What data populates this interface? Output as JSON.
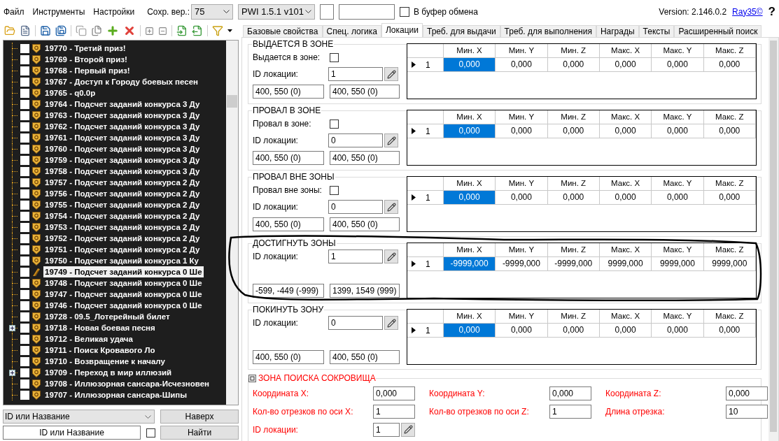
{
  "menu": [
    "Файл",
    "Инструменты",
    "Настройки"
  ],
  "save_version": {
    "label": "Сохр. вер.:",
    "value": "75"
  },
  "game_version": {
    "value": "PWI 1.5.1 v101"
  },
  "clipboard": {
    "label": "В буфер обмена",
    "checked": false
  },
  "version": "Version: 2.146.0.2",
  "author_link": "Ray35©",
  "help": "?",
  "tree": {
    "items": [
      {
        "label": "19770 - Третий приз!",
        "has_children": false,
        "checked": false,
        "selected": false
      },
      {
        "label": "19769 - Второй приз!",
        "has_children": false,
        "checked": false,
        "selected": false
      },
      {
        "label": "19768 - Первый приз!",
        "has_children": false,
        "checked": false,
        "selected": false
      },
      {
        "label": "19767 - Доступ к Городу боевых песен",
        "has_children": false,
        "checked": false,
        "selected": false
      },
      {
        "label": "19765 - q0.0p",
        "has_children": false,
        "checked": false,
        "selected": false
      },
      {
        "label": "19764 - Подсчет заданий конкурса 3 Ду",
        "has_children": false,
        "checked": false,
        "selected": false
      },
      {
        "label": "19763 - Подсчет заданий конкурса 3 Ду",
        "has_children": false,
        "checked": false,
        "selected": false
      },
      {
        "label": "19762 - Подсчет заданий конкурса 3 Ду",
        "has_children": false,
        "checked": false,
        "selected": false
      },
      {
        "label": "19761 - Подсчет заданий конкурса 3 Ду",
        "has_children": false,
        "checked": false,
        "selected": false
      },
      {
        "label": "19760 - Подсчет заданий конкурса 3 Ду",
        "has_children": false,
        "checked": false,
        "selected": false
      },
      {
        "label": "19759 - Подсчет заданий конкурса 3 Ду",
        "has_children": false,
        "checked": false,
        "selected": false
      },
      {
        "label": "19758 - Подсчет заданий конкурса 3 Ду",
        "has_children": false,
        "checked": false,
        "selected": false
      },
      {
        "label": "19757 - Подсчет заданий конкурса 2 Ду",
        "has_children": false,
        "checked": false,
        "selected": false
      },
      {
        "label": "19756 - Подсчет заданий конкурса 2 Ду",
        "has_children": false,
        "checked": false,
        "selected": false
      },
      {
        "label": "19755 - Подсчет заданий конкурса 2 Ду",
        "has_children": false,
        "checked": false,
        "selected": false
      },
      {
        "label": "19754 - Подсчет заданий конкурса 2 Ду",
        "has_children": false,
        "checked": false,
        "selected": false
      },
      {
        "label": "19753 - Подсчет заданий конкурса 2 Ду",
        "has_children": false,
        "checked": false,
        "selected": false
      },
      {
        "label": "19752 - Подсчет заданий конкурса 2 Ду",
        "has_children": false,
        "checked": false,
        "selected": false
      },
      {
        "label": "19751 - Подсчет заданий конкурса 2 Ду",
        "has_children": false,
        "checked": false,
        "selected": false
      },
      {
        "label": "19750 - Подсчет заданий конкурса 1 Ку",
        "has_children": false,
        "checked": false,
        "selected": false
      },
      {
        "label": "19749 - Подсчет заданий конкурса 0 Ше",
        "has_children": false,
        "checked": false,
        "selected": true
      },
      {
        "label": "19748 - Подсчет заданий конкурса 0 Ше",
        "has_children": false,
        "checked": false,
        "selected": false
      },
      {
        "label": "19747 - Подсчет заданий конкурса 0 Ше",
        "has_children": false,
        "checked": false,
        "selected": false
      },
      {
        "label": "19746 - Подсчет заданий конкурса 0 Ше",
        "has_children": false,
        "checked": false,
        "selected": false
      },
      {
        "label": "19728 - 09.5_Лотерейный билет",
        "has_children": false,
        "checked": false,
        "selected": false
      },
      {
        "label": "19718 - Новая боевая песня",
        "has_children": true,
        "checked": false,
        "selected": false
      },
      {
        "label": "19712 - Великая удача",
        "has_children": false,
        "checked": false,
        "selected": false
      },
      {
        "label": "19711 - Поиск Кровавого Ло",
        "has_children": false,
        "checked": false,
        "selected": false
      },
      {
        "label": "19710 - Возвращение к началу",
        "has_children": false,
        "checked": false,
        "selected": false
      },
      {
        "label": "19709 - Переход в мир иллюзий",
        "has_children": true,
        "checked": false,
        "selected": false
      },
      {
        "label": "19708 - Иллюзорная сансара-Исчезновен",
        "has_children": false,
        "checked": false,
        "selected": false
      },
      {
        "label": "19707 - Иллюзорная сансара-Шипы",
        "has_children": false,
        "checked": false,
        "selected": false
      }
    ]
  },
  "search": {
    "mode": "ID или Название",
    "value": "ID или Название",
    "checked": false,
    "top_button": "Наверх",
    "find_button": "Найти"
  },
  "tabs": [
    {
      "label": "Базовые свойства",
      "selected": false
    },
    {
      "label": "Спец. логика",
      "selected": false
    },
    {
      "label": "Локации",
      "selected": true
    },
    {
      "label": "Треб. для выдачи",
      "selected": false
    },
    {
      "label": "Треб. для выполнения",
      "selected": false
    },
    {
      "label": "Награды",
      "selected": false
    },
    {
      "label": "Тексты",
      "selected": false
    },
    {
      "label": "Расширенный поиск",
      "selected": false
    }
  ],
  "zones": [
    {
      "title": "ВЫДАЕТСЯ В ЗОНЕ",
      "checkbox_label": "Выдается в зоне:",
      "checked": false,
      "id_label": "ID локации:",
      "id_value": "1",
      "coord_from": "400, 550 (0)",
      "coord_to": "400, 550 (0)",
      "grid": {
        "columns": [
          "Мин. X",
          "Мин. Y",
          "Мин. Z",
          "Макс. X",
          "Макс. Y",
          "Макс. Z"
        ],
        "rows": [
          {
            "index": "1",
            "cells": [
              {
                "text": "0,000",
                "selected": true
              },
              {
                "text": "0,000",
                "selected": false
              },
              {
                "text": "0,000",
                "selected": false
              },
              {
                "text": "0,000",
                "selected": false
              },
              {
                "text": "0,000",
                "selected": false
              },
              {
                "text": "0,000",
                "selected": false
              }
            ]
          }
        ]
      }
    },
    {
      "title": "ПРОВАЛ В ЗОНЕ",
      "checkbox_label": "Провал в зоне:",
      "checked": false,
      "id_label": "ID локации:",
      "id_value": "0",
      "coord_from": "400, 550 (0)",
      "coord_to": "400, 550 (0)",
      "grid": {
        "columns": [
          "Мин. X",
          "Мин. Y",
          "Мин. Z",
          "Макс. X",
          "Макс. Y",
          "Макс. Z"
        ],
        "rows": [
          {
            "index": "1",
            "cells": [
              {
                "text": "0,000",
                "selected": true
              },
              {
                "text": "0,000",
                "selected": false
              },
              {
                "text": "0,000",
                "selected": false
              },
              {
                "text": "0,000",
                "selected": false
              },
              {
                "text": "0,000",
                "selected": false
              },
              {
                "text": "0,000",
                "selected": false
              }
            ]
          }
        ]
      }
    },
    {
      "title": "ПРОВАЛ ВНЕ ЗОНЫ",
      "checkbox_label": "Провал вне зоны:",
      "checked": false,
      "id_label": "ID локации:",
      "id_value": "0",
      "coord_from": "400, 550 (0)",
      "coord_to": "400, 550 (0)",
      "grid": {
        "columns": [
          "Мин. X",
          "Мин. Y",
          "Мин. Z",
          "Макс. X",
          "Макс. Y",
          "Макс. Z"
        ],
        "rows": [
          {
            "index": "1",
            "cells": [
              {
                "text": "0,000",
                "selected": true
              },
              {
                "text": "0,000",
                "selected": false
              },
              {
                "text": "0,000",
                "selected": false
              },
              {
                "text": "0,000",
                "selected": false
              },
              {
                "text": "0,000",
                "selected": false
              },
              {
                "text": "0,000",
                "selected": false
              }
            ]
          }
        ]
      }
    },
    {
      "title": "ДОСТИГНУТЬ ЗОНЫ",
      "id_label": "ID локации:",
      "id_value": "1",
      "coord_from": "-599, -449 (-999)",
      "coord_to": "1399, 1549 (999)",
      "grid": {
        "columns": [
          "Мин. X",
          "Мин. Y",
          "Мин. Z",
          "Макс. X",
          "Макс. Y",
          "Макс. Z"
        ],
        "rows": [
          {
            "index": "1",
            "cells": [
              {
                "text": "-9999,000",
                "selected": true
              },
              {
                "text": "-9999,000",
                "selected": false
              },
              {
                "text": "-9999,000",
                "selected": false
              },
              {
                "text": "9999,000",
                "selected": false
              },
              {
                "text": "9999,000",
                "selected": false
              },
              {
                "text": "9999,000",
                "selected": false
              }
            ]
          }
        ]
      }
    },
    {
      "title": "ПОКИНУТЬ ЗОНУ",
      "id_label": "ID локации:",
      "id_value": "0",
      "coord_from": "400, 550 (0)",
      "coord_to": "400, 550 (0)",
      "grid": {
        "columns": [
          "Мин. X",
          "Мин. Y",
          "Мин. Z",
          "Макс. X",
          "Макс. Y",
          "Макс. Z"
        ],
        "rows": [
          {
            "index": "1",
            "cells": [
              {
                "text": "0,000",
                "selected": true
              },
              {
                "text": "0,000",
                "selected": false
              },
              {
                "text": "0,000",
                "selected": false
              },
              {
                "text": "0,000",
                "selected": false
              },
              {
                "text": "0,000",
                "selected": false
              },
              {
                "text": "0,000",
                "selected": false
              }
            ]
          }
        ]
      }
    }
  ],
  "treasure": {
    "title": "ЗОНА ПОИСКА СОКРОВИЩА",
    "fields": [
      {
        "label": "Координата X:",
        "value": "0,000",
        "kind": "text"
      },
      {
        "label": "Координата Y:",
        "value": "0,000",
        "kind": "text"
      },
      {
        "label": "Координата Z:",
        "value": "0,000",
        "kind": "text"
      },
      {
        "label": "Кол-во отрезков по оси X:",
        "value": "1",
        "kind": "text"
      },
      {
        "label": "Кол-во отрезков по оси Z:",
        "value": "1",
        "kind": "text"
      },
      {
        "label": "Длина отрезка:",
        "value": "10",
        "kind": "text"
      },
      {
        "label": "ID локации:",
        "value": "1",
        "kind": "pick"
      }
    ]
  }
}
